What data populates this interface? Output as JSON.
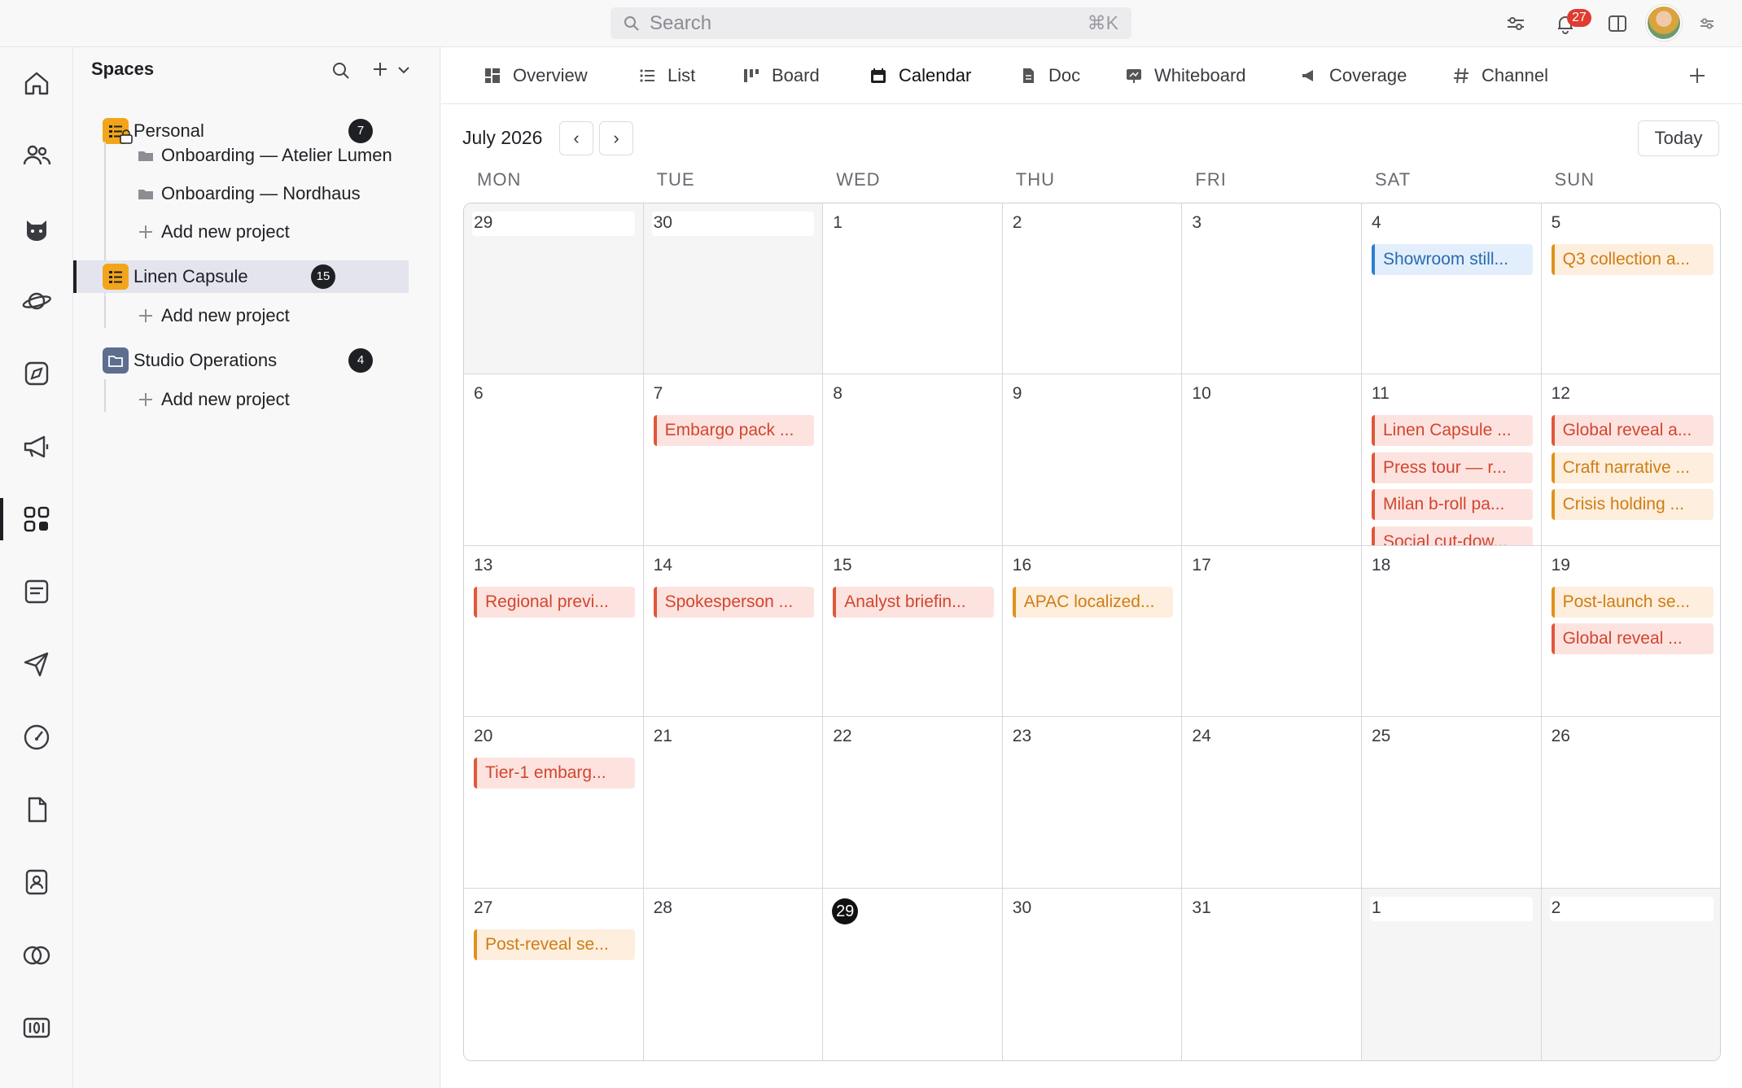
{
  "topbar": {
    "search_placeholder": "Search",
    "search_shortcut": "⌘K",
    "notification_count": "27",
    "icons": [
      "sliders-icon",
      "bell-icon",
      "split-panel-icon",
      "avatar",
      "settings-sliders-icon"
    ]
  },
  "rail": {
    "items": [
      "home-icon",
      "people-icon",
      "cat-icon",
      "planet-icon",
      "compass-icon",
      "megaphone-icon",
      "apps-grid-icon",
      "document-box-icon",
      "send-icon",
      "gauge-icon",
      "file-icon",
      "contact-icon",
      "circles-icon",
      "numbers-icon"
    ],
    "active_index": 6
  },
  "sidebar": {
    "title": "Spaces",
    "spaces": [
      {
        "label": "Personal",
        "count": "7",
        "color": "#f2a51a",
        "children": [
          "Onboarding — Atelier Lumen",
          "Onboarding — Nordhaus"
        ],
        "add_label": "Add new project"
      },
      {
        "label": "Linen Capsule",
        "count": "15",
        "color": "#f2a51a",
        "children": [],
        "add_label": "Add new project"
      },
      {
        "label": "Studio Operations",
        "count": "4",
        "color": "#5d6e8e",
        "children": [],
        "add_label": "Add new project"
      }
    ]
  },
  "tabs": [
    {
      "label": "Overview",
      "icon": "overview-icon"
    },
    {
      "label": "List",
      "icon": "list-icon"
    },
    {
      "label": "Board",
      "icon": "board-icon"
    },
    {
      "label": "Calendar",
      "icon": "calendar-icon"
    },
    {
      "label": "Doc",
      "icon": "doc-icon"
    },
    {
      "label": "Whiteboard",
      "icon": "whiteboard-icon"
    },
    {
      "label": "Coverage",
      "icon": "megaphone-icon"
    },
    {
      "label": "Channel",
      "icon": "hash-icon"
    }
  ],
  "calendar": {
    "month_label": "July 2026",
    "prev_label": "‹",
    "next_label": "›",
    "today_label": "Today",
    "weekdays": [
      "MON",
      "TUE",
      "WED",
      "THU",
      "FRI",
      "SAT",
      "SUN"
    ],
    "weeks": [
      [
        {
          "day": "29",
          "muted": true,
          "events": []
        },
        {
          "day": "30",
          "muted": true,
          "events": []
        },
        {
          "day": "1",
          "events": []
        },
        {
          "day": "2",
          "events": []
        },
        {
          "day": "3",
          "events": []
        },
        {
          "day": "4",
          "events": [
            {
              "title": "Showroom still...",
              "color": "blue"
            }
          ]
        },
        {
          "day": "5",
          "events": [
            {
              "title": "Q3 collection a...",
              "color": "orange"
            }
          ]
        }
      ],
      [
        {
          "day": "6",
          "events": []
        },
        {
          "day": "7",
          "events": [
            {
              "title": "Embargo pack ...",
              "color": "red"
            }
          ]
        },
        {
          "day": "8",
          "events": []
        },
        {
          "day": "9",
          "events": []
        },
        {
          "day": "10",
          "events": []
        },
        {
          "day": "11",
          "events": [
            {
              "title": "Linen Capsule ...",
              "color": "red"
            },
            {
              "title": "Press tour — r...",
              "color": "red"
            },
            {
              "title": "Milan b-roll pa...",
              "color": "red"
            },
            {
              "title": "Social cut-dow...",
              "color": "red"
            }
          ]
        },
        {
          "day": "12",
          "events": [
            {
              "title": "Global reveal a...",
              "color": "red"
            },
            {
              "title": "Craft narrative ...",
              "color": "orange"
            },
            {
              "title": "Crisis holding ...",
              "color": "orange"
            }
          ]
        }
      ],
      [
        {
          "day": "13",
          "events": [
            {
              "title": "Regional previ...",
              "color": "red"
            }
          ]
        },
        {
          "day": "14",
          "events": [
            {
              "title": "Spokesperson ...",
              "color": "red"
            }
          ]
        },
        {
          "day": "15",
          "events": [
            {
              "title": "Analyst briefin...",
              "color": "red"
            }
          ]
        },
        {
          "day": "16",
          "events": [
            {
              "title": "APAC localized...",
              "color": "orange"
            }
          ]
        },
        {
          "day": "17",
          "events": []
        },
        {
          "day": "18",
          "events": []
        },
        {
          "day": "19",
          "events": [
            {
              "title": "Post-launch se...",
              "color": "orange"
            },
            {
              "title": "Global reveal ...",
              "color": "red"
            }
          ]
        }
      ],
      [
        {
          "day": "20",
          "events": [
            {
              "title": "Tier-1 embarg...",
              "color": "red"
            }
          ]
        },
        {
          "day": "21",
          "events": []
        },
        {
          "day": "22",
          "events": []
        },
        {
          "day": "23",
          "events": []
        },
        {
          "day": "24",
          "events": []
        },
        {
          "day": "25",
          "events": []
        },
        {
          "day": "26",
          "events": []
        }
      ],
      [
        {
          "day": "27",
          "events": [
            {
              "title": "Post-reveal se...",
              "color": "orange"
            }
          ]
        },
        {
          "day": "28",
          "events": []
        },
        {
          "day": "29",
          "today": true,
          "events": []
        },
        {
          "day": "30",
          "events": []
        },
        {
          "day": "31",
          "events": []
        },
        {
          "day": "1",
          "muted": true,
          "events": []
        },
        {
          "day": "2",
          "muted": true,
          "events": []
        }
      ]
    ]
  },
  "colors": {
    "accent": "#1f2024",
    "event_red": "#e0573a",
    "event_orange": "#e0921c",
    "event_blue": "#2f7ed1",
    "badge_red": "#e03b30"
  }
}
